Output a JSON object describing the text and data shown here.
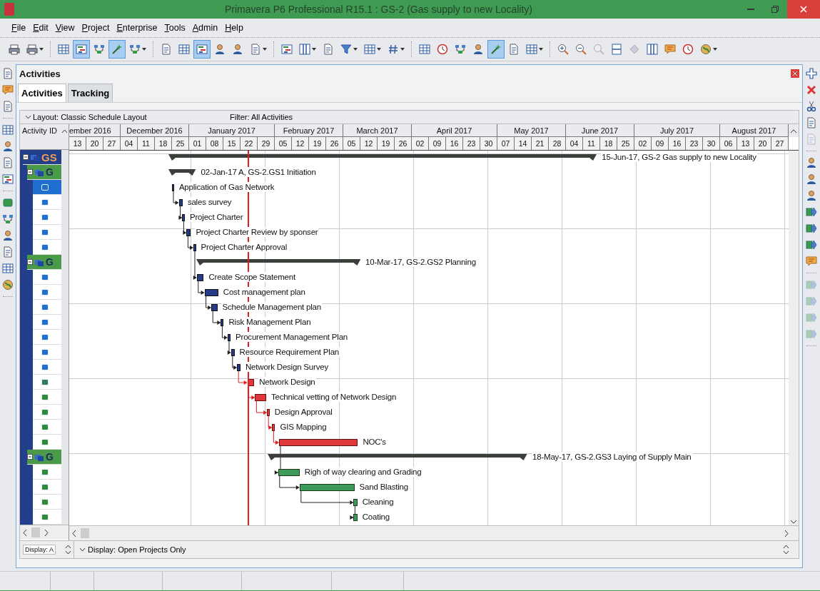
{
  "window": {
    "title": "Primavera P6 Professional R15.1 : GS-2 (Gas supply to new Locality)"
  },
  "menu": [
    {
      "label": "File"
    },
    {
      "label": "Edit"
    },
    {
      "label": "View"
    },
    {
      "label": "Project"
    },
    {
      "label": "Enterprise"
    },
    {
      "label": "Tools"
    },
    {
      "label": "Admin"
    },
    {
      "label": "Help"
    }
  ],
  "toolbar": [
    {
      "kind": "printer",
      "selected": false,
      "dropdown": false
    },
    {
      "kind": "printer",
      "selected": false,
      "dropdown": true
    },
    {
      "kind": "sep"
    },
    {
      "kind": "grid",
      "selected": false,
      "dropdown": false
    },
    {
      "kind": "bars",
      "selected": true,
      "dropdown": false
    },
    {
      "kind": "nodes",
      "selected": false,
      "dropdown": false
    },
    {
      "kind": "wand",
      "selected": true,
      "dropdown": false
    },
    {
      "kind": "nodes",
      "selected": false,
      "dropdown": true
    },
    {
      "kind": "sep"
    },
    {
      "kind": "sheet",
      "selected": false,
      "dropdown": false
    },
    {
      "kind": "grid",
      "selected": false,
      "dropdown": false
    },
    {
      "kind": "bars",
      "selected": true,
      "dropdown": false
    },
    {
      "kind": "person",
      "selected": false,
      "dropdown": false
    },
    {
      "kind": "person",
      "selected": false,
      "dropdown": false
    },
    {
      "kind": "sheet",
      "selected": false,
      "dropdown": true
    },
    {
      "kind": "sep"
    },
    {
      "kind": "bars",
      "selected": false,
      "dropdown": false
    },
    {
      "kind": "columns",
      "selected": false,
      "dropdown": true
    },
    {
      "kind": "sheet",
      "selected": false,
      "dropdown": false
    },
    {
      "kind": "funnel",
      "selected": false,
      "dropdown": true
    },
    {
      "kind": "grid",
      "selected": false,
      "dropdown": true
    },
    {
      "kind": "hash",
      "selected": false,
      "dropdown": true
    },
    {
      "kind": "sep"
    },
    {
      "kind": "grid",
      "selected": false,
      "dropdown": false
    },
    {
      "kind": "clock",
      "selected": false,
      "dropdown": false
    },
    {
      "kind": "nodes",
      "selected": false,
      "dropdown": false
    },
    {
      "kind": "person",
      "selected": false,
      "dropdown": false
    },
    {
      "kind": "wand",
      "selected": true,
      "dropdown": false
    },
    {
      "kind": "sheet",
      "selected": false,
      "dropdown": false
    },
    {
      "kind": "grid",
      "selected": false,
      "dropdown": true
    },
    {
      "kind": "sep"
    },
    {
      "kind": "zoomin",
      "selected": false,
      "dropdown": false
    },
    {
      "kind": "zoomout",
      "selected": false,
      "dropdown": false
    },
    {
      "kind": "magnifier",
      "selected": false,
      "dropdown": false
    },
    {
      "kind": "split",
      "selected": false,
      "dropdown": false
    },
    {
      "kind": "diamond",
      "selected": false,
      "dropdown": false
    },
    {
      "kind": "columns",
      "selected": false,
      "dropdown": false
    },
    {
      "kind": "note",
      "selected": false,
      "dropdown": false
    },
    {
      "kind": "clock",
      "selected": false,
      "dropdown": false
    },
    {
      "kind": "globe",
      "selected": false,
      "dropdown": true
    }
  ],
  "left_dock": [
    {
      "kind": "sheet"
    },
    {
      "kind": "note"
    },
    {
      "kind": "sheet"
    },
    {
      "kind": "sep"
    },
    {
      "kind": "grid"
    },
    {
      "kind": "person"
    },
    {
      "kind": "sheet"
    },
    {
      "kind": "bars"
    },
    {
      "kind": "sep"
    },
    {
      "kind": "disk"
    },
    {
      "kind": "nodes"
    },
    {
      "kind": "person"
    },
    {
      "kind": "sheet"
    },
    {
      "kind": "grid"
    },
    {
      "kind": "globe"
    },
    {
      "kind": "sep"
    }
  ],
  "right_dock": [
    {
      "kind": "plus",
      "disabled": false
    },
    {
      "kind": "delete",
      "disabled": false
    },
    {
      "kind": "scissors",
      "disabled": false
    },
    {
      "kind": "sheet",
      "disabled": false
    },
    {
      "kind": "sheet",
      "disabled": true
    },
    {
      "kind": "sep"
    },
    {
      "kind": "person",
      "disabled": false
    },
    {
      "kind": "person",
      "disabled": false
    },
    {
      "kind": "person",
      "disabled": false
    },
    {
      "kind": "arrow",
      "disabled": false
    },
    {
      "kind": "arrow",
      "disabled": false
    },
    {
      "kind": "arrow",
      "disabled": false
    },
    {
      "kind": "note",
      "disabled": false
    },
    {
      "kind": "sep"
    },
    {
      "kind": "arrow",
      "disabled": true
    },
    {
      "kind": "arrow",
      "disabled": true
    },
    {
      "kind": "arrow",
      "disabled": true
    },
    {
      "kind": "arrow",
      "disabled": true
    },
    {
      "kind": "sep"
    }
  ],
  "panel": {
    "title": "Activities",
    "tabs": [
      {
        "label": "Activities",
        "selected": true
      },
      {
        "label": "Tracking",
        "selected": false
      }
    ],
    "layout_label": "Layout: Classic Schedule Layout",
    "filter_label": "Filter: All Activities",
    "id_column": {
      "label": "Activity ID"
    },
    "id_rows": [
      {
        "kind": "project",
        "label": "GS",
        "selected": false
      },
      {
        "kind": "wbs",
        "label": "G",
        "selected": false
      },
      {
        "kind": "activity",
        "selected": true,
        "color": "#1f6fd0"
      },
      {
        "kind": "activity",
        "selected": false,
        "color": "#1f6fd0"
      },
      {
        "kind": "activity",
        "selected": false,
        "color": "#1f6fd0"
      },
      {
        "kind": "activity",
        "selected": false,
        "color": "#1f6fd0"
      },
      {
        "kind": "activity",
        "selected": false,
        "color": "#1f6fd0"
      },
      {
        "kind": "wbs",
        "label": "G",
        "selected": false
      },
      {
        "kind": "activity",
        "selected": false,
        "color": "#1f6fd0"
      },
      {
        "kind": "activity",
        "selected": false,
        "color": "#1f6fd0"
      },
      {
        "kind": "activity",
        "selected": false,
        "color": "#1f6fd0"
      },
      {
        "kind": "activity",
        "selected": false,
        "color": "#1f6fd0"
      },
      {
        "kind": "activity",
        "selected": false,
        "color": "#1f6fd0"
      },
      {
        "kind": "activity",
        "selected": false,
        "color": "#1f6fd0"
      },
      {
        "kind": "activity",
        "selected": false,
        "color": "#1f6fd0"
      },
      {
        "kind": "activity",
        "selected": false,
        "color": "#2a7f5a"
      },
      {
        "kind": "activity",
        "selected": false,
        "color": "#2e8b3a"
      },
      {
        "kind": "activity",
        "selected": false,
        "color": "#2e8b3a"
      },
      {
        "kind": "activity",
        "selected": false,
        "color": "#2e8b3a"
      },
      {
        "kind": "activity",
        "selected": false,
        "color": "#2e8b3a"
      },
      {
        "kind": "wbs",
        "label": "G",
        "selected": false
      },
      {
        "kind": "activity",
        "selected": false,
        "color": "#2e8b3a"
      },
      {
        "kind": "activity",
        "selected": false,
        "color": "#2e8b3a"
      },
      {
        "kind": "activity",
        "selected": false,
        "color": "#2e8b3a"
      },
      {
        "kind": "activity",
        "selected": false,
        "color": "#2e8b3a"
      }
    ],
    "months": [
      "ember 2016",
      "December 2016",
      "January 2017",
      "February 2017",
      "March 2017",
      "April 2017",
      "May 2017",
      "June 2017",
      "July 2017",
      "August 2017"
    ],
    "weeks": [
      "13",
      "20",
      "27",
      "04",
      "11",
      "18",
      "25",
      "01",
      "08",
      "15",
      "22",
      "29",
      "05",
      "12",
      "19",
      "26",
      "05",
      "12",
      "19",
      "26",
      "02",
      "09",
      "16",
      "23",
      "30",
      "07",
      "14",
      "21",
      "28",
      "04",
      "11",
      "18",
      "25",
      "02",
      "09",
      "16",
      "23",
      "30",
      "06",
      "13",
      "20",
      "27"
    ],
    "gantt_rows": [
      {
        "kind": "summary",
        "label": "15-Jun-17, GS-2  Gas supply to new Locality"
      },
      {
        "kind": "summary",
        "label": "02-Jan-17 A, GS-2.GS1  Initiation"
      },
      {
        "kind": "actual",
        "label": "Application of Gas Network"
      },
      {
        "kind": "actual",
        "label": "sales survey"
      },
      {
        "kind": "actual",
        "label": "Project Charter"
      },
      {
        "kind": "actual",
        "label": "Project Charter Review by sponser"
      },
      {
        "kind": "actual",
        "label": "Project Charter Approval"
      },
      {
        "kind": "summary",
        "label": "10-Mar-17, GS-2.GS2  Planning"
      },
      {
        "kind": "actual",
        "label": "Create Scope Statement"
      },
      {
        "kind": "actual",
        "label": "Cost management plan"
      },
      {
        "kind": "actual",
        "label": "Schedule Management plan"
      },
      {
        "kind": "actual",
        "label": "Risk Management Plan"
      },
      {
        "kind": "actual",
        "label": "Procurement Management Plan"
      },
      {
        "kind": "actual",
        "label": "Resource Requirement Plan"
      },
      {
        "kind": "actual",
        "label": "Network Design Survey"
      },
      {
        "kind": "critical",
        "label": "Network Design"
      },
      {
        "kind": "critical",
        "label": "Technical vetting of Network Design"
      },
      {
        "kind": "critical",
        "label": "Design Approval"
      },
      {
        "kind": "critical",
        "label": "GIS Mapping"
      },
      {
        "kind": "critical",
        "label": "NOC's"
      },
      {
        "kind": "summary",
        "label": "18-May-17, GS-2.GS3  Laying of Supply Main"
      },
      {
        "kind": "remaining",
        "label": "Righ of way clearing and Grading"
      },
      {
        "kind": "remaining",
        "label": "Sand Blasting"
      },
      {
        "kind": "remaining",
        "label": "Cleaning"
      },
      {
        "kind": "remaining",
        "label": "Coating"
      }
    ],
    "bottom_field": "Display: A",
    "display_label": "Display: Open Projects Only"
  }
}
